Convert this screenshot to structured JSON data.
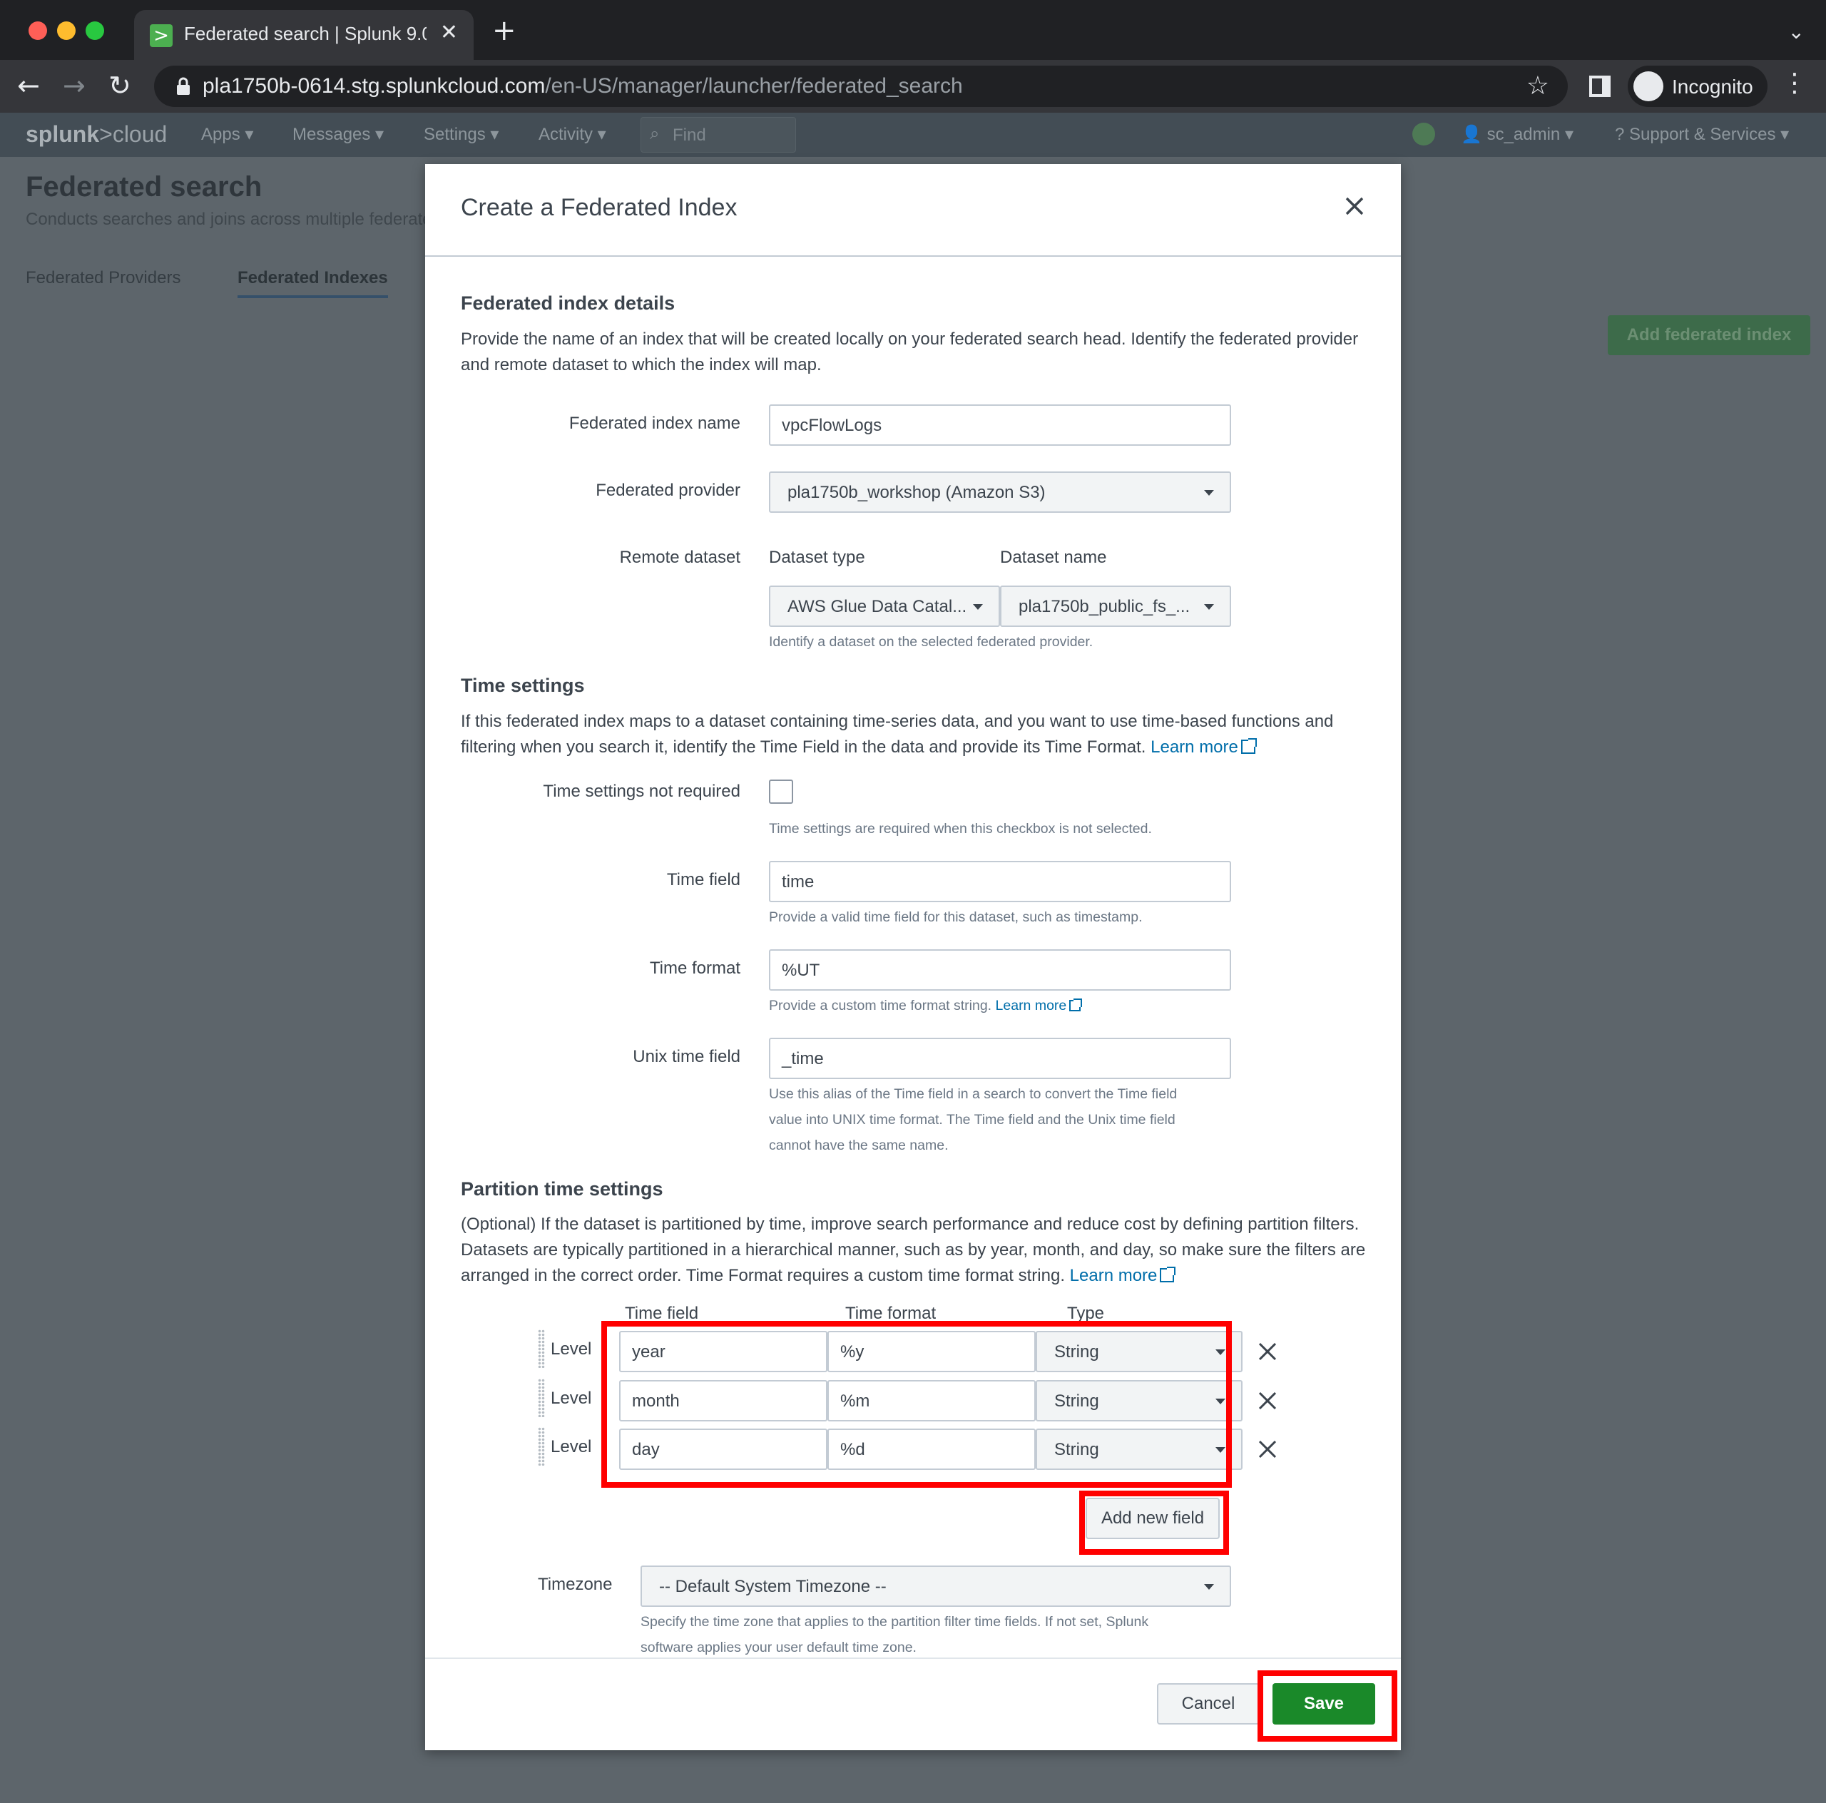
{
  "browser": {
    "tab_title": "Federated search | Splunk 9.0.",
    "url_host": "pla1750b-0614.stg.splunkcloud.com",
    "url_path": "/en-US/manager/launcher/federated_search",
    "incognito_label": "Incognito",
    "icons": [
      "back-icon",
      "forward-icon",
      "reload-icon",
      "lock-icon",
      "star-icon",
      "side-panel-icon",
      "incognito-icon",
      "menu-icon"
    ]
  },
  "splunk": {
    "logo_main": "splunk",
    "logo_suffix": ">cloud",
    "nav": {
      "apps": "Apps ▾",
      "messages": "Messages ▾",
      "settings": "Settings ▾",
      "activity": "Activity ▾"
    },
    "find_placeholder": "Find",
    "user": "sc_admin ▾",
    "support": "Support & Services ▾"
  },
  "page": {
    "title": "Federated search",
    "subtitle": "Conducts searches and joins across multiple federated",
    "tabs": [
      "Federated Providers",
      "Federated Indexes"
    ],
    "add_button": "Add federated index"
  },
  "modal": {
    "title": "Create a Federated Index",
    "details": {
      "heading": "Federated index details",
      "description": "Provide the name of an index that will be created locally on your federated search head. Identify the federated provider and remote dataset to which the index will map.",
      "index_name_label": "Federated index name",
      "index_name_value": "vpcFlowLogs",
      "provider_label": "Federated provider",
      "provider_value": "pla1750b_workshop (Amazon S3)",
      "remote_dataset_label": "Remote dataset",
      "dataset_type_label": "Dataset type",
      "dataset_name_label": "Dataset name",
      "dataset_type_value": "AWS Glue Data Catal...",
      "dataset_name_value": "pla1750b_public_fs_...",
      "dataset_help": "Identify a dataset on the selected federated provider."
    },
    "time": {
      "heading": "Time settings",
      "description": "If this federated index maps to a dataset containing time-series data, and you want to use time-based functions and filtering when you search it, identify the Time Field in the data and provide its Time Format.",
      "learn_more": "Learn more",
      "not_required_label": "Time settings not required",
      "not_required_help": "Time settings are required when this checkbox is not selected.",
      "time_field_label": "Time field",
      "time_field_value": "time",
      "time_field_help": "Provide a valid time field for this dataset, such as timestamp.",
      "time_format_label": "Time format",
      "time_format_value": "%UT",
      "time_format_help": "Provide a custom time format string.",
      "time_format_learn_more": "Learn more",
      "unix_label": "Unix time field",
      "unix_value": "_time",
      "unix_help_1": "Use this alias of the Time field in a search to convert the Time field",
      "unix_help_2": "value into UNIX time format. The Time field and the Unix time field",
      "unix_help_3": "cannot have the same name."
    },
    "partition": {
      "heading": "Partition time settings",
      "description": "(Optional) If the dataset is partitioned by time, improve search performance and reduce cost by defining partition filters. Datasets are typically partitioned in a hierarchical manner, such as by year, month, and day, so make sure the filters are arranged in the correct order. Time Format requires a custom time format string.",
      "learn_more": "Learn more",
      "columns": [
        "Time field",
        "Time format",
        "Type"
      ],
      "rows": [
        {
          "level": "Level 1",
          "field": "year",
          "format": "%y",
          "type": "String"
        },
        {
          "level": "Level 2",
          "field": "month",
          "format": "%m",
          "type": "String"
        },
        {
          "level": "Level 3",
          "field": "day",
          "format": "%d",
          "type": "String"
        }
      ],
      "add_field": "Add new field",
      "timezone_label": "Timezone",
      "timezone_value": "-- Default System Timezone --",
      "timezone_help_1": "Specify the time zone that applies to the partition filter time fields. If not set, Splunk",
      "timezone_help_2": "software applies your user default time zone."
    },
    "footer": {
      "cancel": "Cancel",
      "save": "Save"
    }
  },
  "colors": {
    "primary_green": "#1a8929",
    "link_blue": "#006eaa",
    "highlight_red": "#ff0000",
    "overlay": "#5d656b"
  }
}
